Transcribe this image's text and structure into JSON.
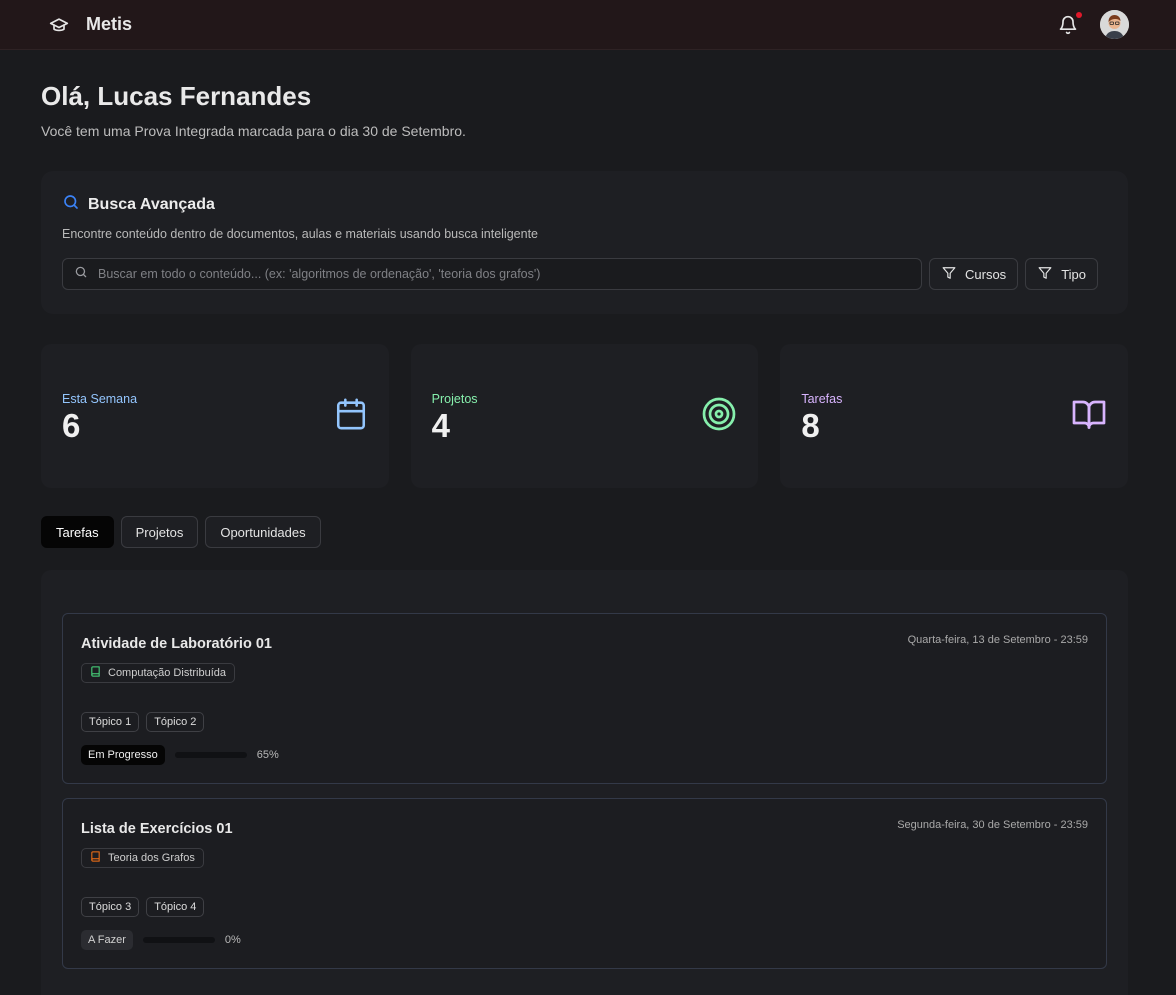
{
  "app": {
    "name": "Metis"
  },
  "header": {
    "notification_icon": "bell-icon",
    "notification_color": "#e0182a"
  },
  "greeting": {
    "title": "Olá, Lucas Fernandes",
    "subtitle": "Você tem uma Prova Integrada marcada para o dia 30 de Setembro."
  },
  "search": {
    "title": "Busca Avançada",
    "description": "Encontre conteúdo dentro de documentos, aulas e materiais usando busca inteligente",
    "placeholder": "Buscar em todo o conteúdo... (ex: 'algoritmos de ordenação', 'teoria dos grafos')",
    "filters": {
      "courses": "Cursos",
      "type": "Tipo"
    },
    "accent": "#3b82f6"
  },
  "stats": [
    {
      "label": "Esta Semana",
      "value": "6",
      "color": "#93c5fd",
      "icon": "calendar-icon"
    },
    {
      "label": "Projetos",
      "value": "4",
      "color": "#86efac",
      "icon": "target-icon"
    },
    {
      "label": "Tarefas",
      "value": "8",
      "color": "#d8b4fe",
      "icon": "book-icon"
    }
  ],
  "tabs": [
    {
      "label": "Tarefas",
      "active": true
    },
    {
      "label": "Projetos",
      "active": false
    },
    {
      "label": "Oportunidades",
      "active": false
    }
  ],
  "tasks": [
    {
      "title": "Atividade de Laboratório 01",
      "date": "Quarta-feira, 13 de Setembro - 23:59",
      "course": "Computação Distribuída",
      "course_color": "#4ade80",
      "topics": [
        "Tópico 1",
        "Tópico 2"
      ],
      "status": "Em Progresso",
      "progress": 65,
      "progress_label": "65%"
    },
    {
      "title": "Lista de Exercícios 01",
      "date": "Segunda-feira, 30 de Setembro - 23:59",
      "course": "Teoria dos Grafos",
      "course_color": "#f97316",
      "topics": [
        "Tópico 3",
        "Tópico 4"
      ],
      "status": "A Fazer",
      "progress": 0,
      "progress_label": "0%"
    }
  ]
}
